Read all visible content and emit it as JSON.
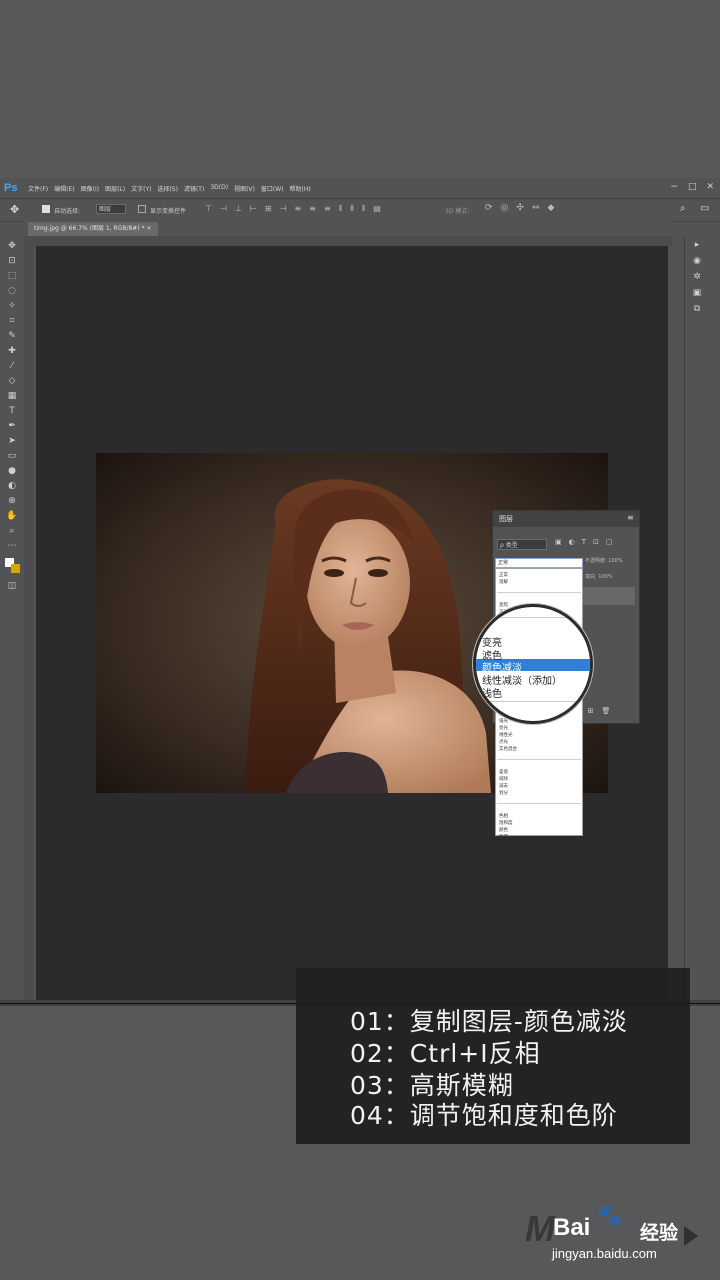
{
  "app": {
    "logo": "Ps"
  },
  "menu": [
    "文件(F)",
    "编辑(E)",
    "图像(I)",
    "图层(L)",
    "文字(Y)",
    "选择(S)",
    "滤镜(T)",
    "3D(D)",
    "视图(V)",
    "窗口(W)",
    "帮助(H)"
  ],
  "window_controls": [
    "−",
    "□",
    "✕"
  ],
  "options_bar": {
    "auto_select_label": "自动选择:",
    "auto_select_value": "图层",
    "transform_label": "显示变换控件",
    "mode_3d_label": "3D 模式:"
  },
  "document_tab": {
    "label": "timg.jpg @ 66.7% (图层 1, RGB/8#) *",
    "close": "×"
  },
  "layers_panel": {
    "title": "图层",
    "kind_filter": "ρ 类型",
    "blend_mode_selected": "正常",
    "opacity_label": "不透明度: 100%",
    "fill_label": "填充: 100%"
  },
  "blend_menu": {
    "groups": [
      [
        "正常",
        "溶解"
      ],
      [
        "变暗",
        "正片叠底",
        "颜色加深",
        "线性加深",
        "深色"
      ],
      [
        "变亮",
        "滤色",
        "颜色减淡",
        "线性减淡（添加）",
        "浅色"
      ],
      [
        "叠加",
        "柔光",
        "强光",
        "亮光",
        "线性光",
        "点光",
        "实色混合"
      ],
      [
        "差值",
        "排除",
        "减去",
        "划分"
      ],
      [
        "色相",
        "饱和度",
        "颜色",
        "明度"
      ]
    ],
    "highlighted": "颜色减淡"
  },
  "magnifier_items": [
    "变亮",
    "滤色",
    "颜色减淡",
    "线性减淡（添加）",
    "浅色"
  ],
  "steps": [
    "01：复制图层-颜色减淡",
    "02：Ctrl+I反相",
    "03：高斯模糊",
    "04：调节饱和度和色阶"
  ],
  "watermark": {
    "mark": "M",
    "brand": "Bai",
    "brand2": "经验",
    "url": "jingyan.baidu.com"
  },
  "colors": {
    "ps_ui": "#535353",
    "pasteboard": "#2b2b2d",
    "highlight": "#2f7fd6",
    "ps_logo": "#4aa3f0"
  }
}
